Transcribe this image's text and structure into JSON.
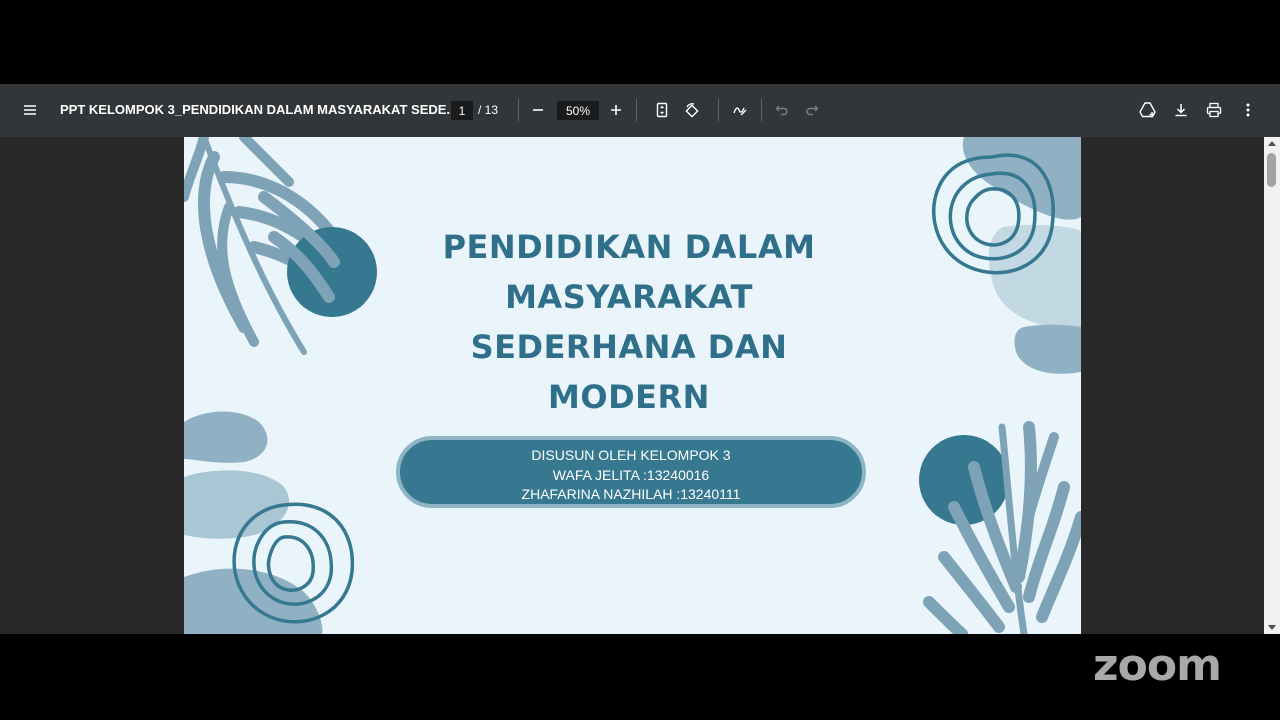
{
  "toolbar": {
    "menu_icon": "hamburger-menu-icon",
    "document_title": "PPT KELOMPOK 3_PENDIDIKAN DALAM MASYARAKAT SEDE...",
    "current_page": "1",
    "total_pages": "/ 13",
    "zoom_level": "50%",
    "icons": [
      "zoom-out-icon",
      "zoom-in-icon",
      "fit-page-icon",
      "rotate-icon",
      "annotate-icon",
      "undo-icon",
      "redo-icon",
      "save-to-drive-icon",
      "download-icon",
      "print-icon",
      "more-options-icon"
    ]
  },
  "slide": {
    "title_lines": [
      "PENDIDIKAN DALAM",
      "MASYARAKAT",
      "SEDERHANA DAN",
      "MODERN"
    ],
    "info_lines": [
      "DISUSUN OLEH KELOMPOK 3",
      "WAFA JELITA :13240016",
      "ZHAFARINA NAZHILAH :13240111"
    ],
    "colors": {
      "background": "#e9f5fb",
      "title": "#2f6f8a",
      "teal": "#36788f",
      "leaf": "#7ea2b6",
      "soft": "#a9c6d5"
    }
  },
  "watermark": {
    "text": "zoom"
  }
}
